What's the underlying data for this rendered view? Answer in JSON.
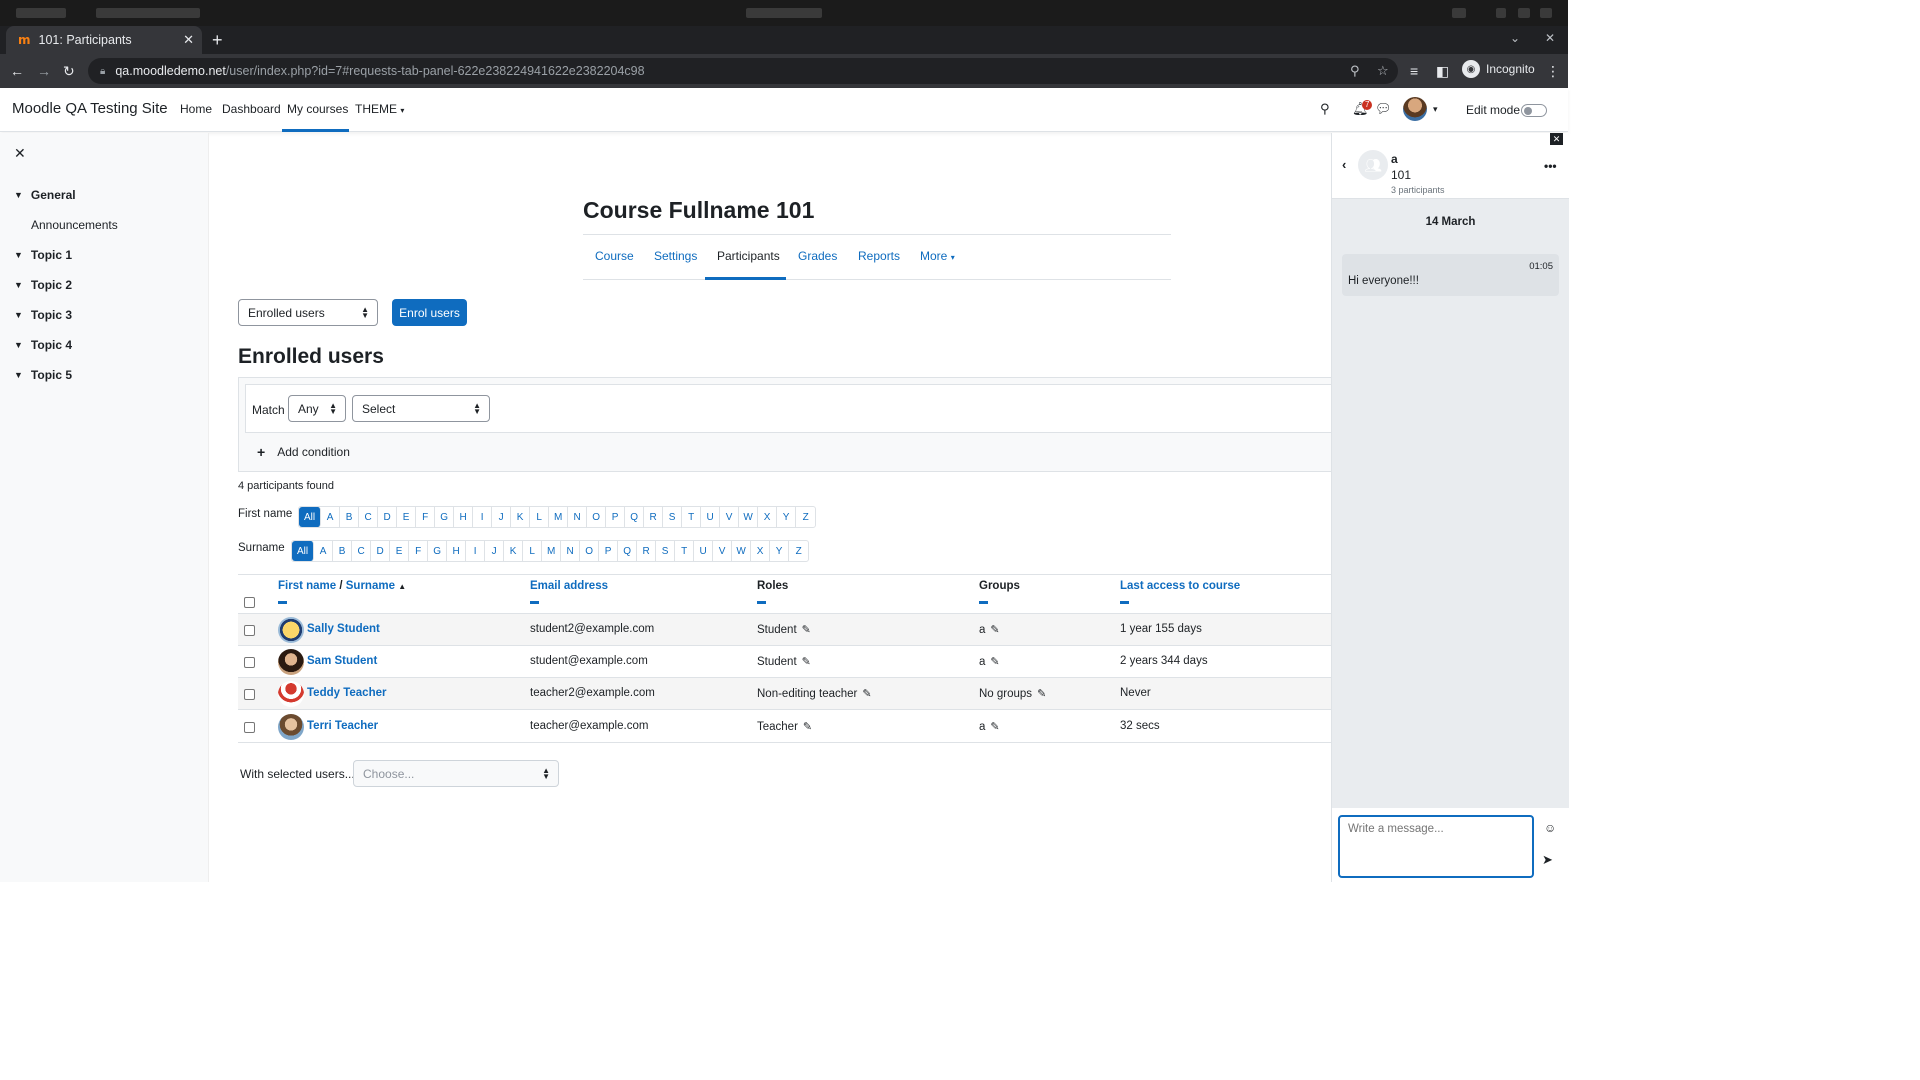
{
  "browser": {
    "tab_title": "101: Participants",
    "tab_favicon": "m",
    "url_host": "qa.moodledemo.net",
    "url_path": "/user/index.php?id=7#requests-tab-panel-622e238224941622e2382204c98",
    "incognito_label": "Incognito"
  },
  "navbar": {
    "site_name": "Moodle QA Testing Site",
    "links": [
      "Home",
      "Dashboard",
      "My courses",
      "THEME"
    ],
    "notification_count": "7",
    "edit_mode_label": "Edit mode"
  },
  "drawer": {
    "sections": [
      "General",
      "Topic 1",
      "Topic 2",
      "Topic 3",
      "Topic 4",
      "Topic 5"
    ],
    "general_item": "Announcements"
  },
  "course": {
    "title": "Course Fullname 101",
    "tabs": [
      "Course",
      "Settings",
      "Participants",
      "Grades",
      "Reports",
      "More"
    ],
    "active_tab": "Participants"
  },
  "participants": {
    "view_select": "Enrolled users",
    "enrol_button": "Enrol users",
    "heading": "Enrolled users",
    "filter": {
      "match_label": "Match",
      "match_value": "Any",
      "type_value": "Select",
      "add_condition": "Add condition"
    },
    "found_text": "4 participants found",
    "firstname_label": "First name",
    "surname_label": "Surname",
    "letters": [
      "All",
      "A",
      "B",
      "C",
      "D",
      "E",
      "F",
      "G",
      "H",
      "I",
      "J",
      "K",
      "L",
      "M",
      "N",
      "O",
      "P",
      "Q",
      "R",
      "S",
      "T",
      "U",
      "V",
      "W",
      "X",
      "Y",
      "Z"
    ],
    "columns": {
      "firstname": "First name",
      "separator": " / ",
      "surname": "Surname",
      "email": "Email address",
      "roles": "Roles",
      "groups": "Groups",
      "last_access": "Last access to course"
    },
    "rows": [
      {
        "name": "Sally Student",
        "email": "student2@example.com",
        "role": "Student",
        "groups": "a",
        "last_access": "1 year 155 days"
      },
      {
        "name": "Sam Student",
        "email": "student@example.com",
        "role": "Student",
        "groups": "a",
        "last_access": "2 years 344 days"
      },
      {
        "name": "Teddy Teacher",
        "email": "teacher2@example.com",
        "role": "Non-editing teacher",
        "groups": "No groups",
        "last_access": "Never"
      },
      {
        "name": "Terri Teacher",
        "email": "teacher@example.com",
        "role": "Teacher",
        "groups": "a",
        "last_access": "32 secs"
      }
    ],
    "with_selected_label": "With selected users...",
    "with_selected_placeholder": "Choose..."
  },
  "messaging": {
    "conversation_name": "a",
    "course": "101",
    "participants": "3 participants",
    "date": "14 March",
    "messages": [
      {
        "time": "01:05",
        "text": "Hi everyone!!!"
      }
    ],
    "input_placeholder": "Write a message..."
  }
}
